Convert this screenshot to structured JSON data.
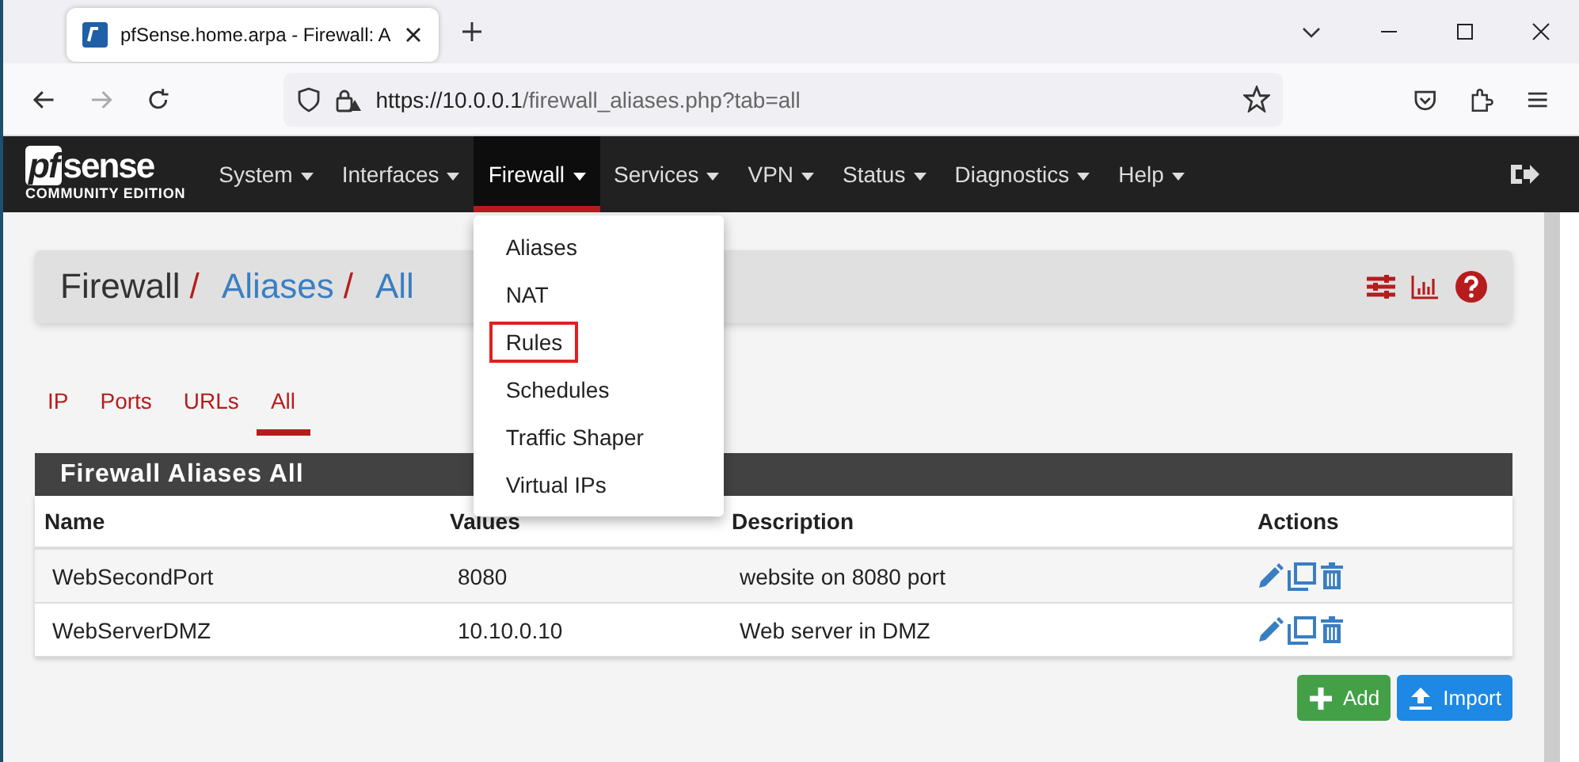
{
  "browser": {
    "tab_title": "pfSense.home.arpa - Firewall: A",
    "url_host": "https://10.0.0.1",
    "url_path": "/firewall_aliases.php?tab=all"
  },
  "logo": {
    "mark_a": "pf",
    "mark_b": "sense",
    "edition": "COMMUNITY EDITION"
  },
  "nav": [
    {
      "label": "System",
      "selected": false
    },
    {
      "label": "Interfaces",
      "selected": false
    },
    {
      "label": "Firewall",
      "selected": true
    },
    {
      "label": "Services",
      "selected": false
    },
    {
      "label": "VPN",
      "selected": false
    },
    {
      "label": "Status",
      "selected": false
    },
    {
      "label": "Diagnostics",
      "selected": false
    },
    {
      "label": "Help",
      "selected": false
    }
  ],
  "dropdown": [
    {
      "label": "Aliases",
      "outlined": false
    },
    {
      "label": "NAT",
      "outlined": false
    },
    {
      "label": "Rules",
      "outlined": true
    },
    {
      "label": "Schedules",
      "outlined": false
    },
    {
      "label": "Traffic Shaper",
      "outlined": false
    },
    {
      "label": "Virtual IPs",
      "outlined": false
    }
  ],
  "breadcrumb_separator": "/",
  "breadcrumb": [
    {
      "label": "Firewall",
      "kind": "text"
    },
    {
      "label": "Aliases",
      "kind": "link"
    },
    {
      "label": "All",
      "kind": "link"
    }
  ],
  "tabs": [
    {
      "label": "IP",
      "selected": false
    },
    {
      "label": "Ports",
      "selected": false
    },
    {
      "label": "URLs",
      "selected": false
    },
    {
      "label": "All",
      "selected": true
    }
  ],
  "table": {
    "title": "Firewall Aliases All",
    "columns": [
      "Name",
      "Values",
      "Description",
      "Actions"
    ],
    "rows": [
      {
        "name": "WebSecondPort",
        "values": "8080",
        "description": "website on 8080 port"
      },
      {
        "name": "WebServerDMZ",
        "values": "10.10.0.10",
        "description": "Web server in DMZ"
      }
    ]
  },
  "buttons": [
    {
      "label": "Add",
      "kind": "add"
    },
    {
      "label": "Import",
      "kind": "import"
    }
  ]
}
